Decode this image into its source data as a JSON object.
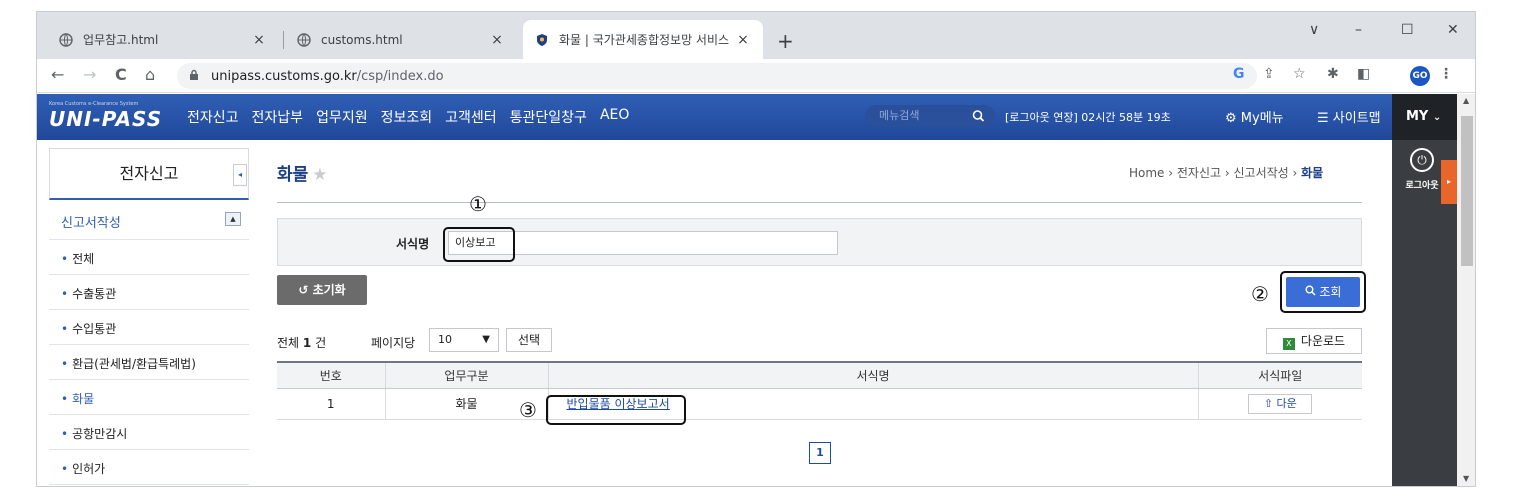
{
  "browser": {
    "tabs": [
      {
        "title": "업무참고.html",
        "close": "×"
      },
      {
        "title": "customs.html",
        "close": "×"
      },
      {
        "title": "화물 | 국가관세종합정보망 서비스",
        "close": "×"
      }
    ],
    "new_tab": "+",
    "window_controls": {
      "menu": "∨",
      "minimize": "–",
      "maximize": "☐",
      "close": "✕"
    },
    "nav": {
      "back": "←",
      "forward": "→",
      "reload": "C",
      "home": "⌂"
    },
    "url_domain": "unipass.customs.go.kr",
    "url_path": "/csp/index.do",
    "profile_initials": "GO"
  },
  "site": {
    "logo_tagline": "Korea Customs e-Clearance System",
    "logo_text": "UNI-PASS",
    "menu": [
      "전자신고",
      "전자납부",
      "업무지원",
      "정보조회",
      "고객센터",
      "통관단일창구",
      "AEO"
    ],
    "search_placeholder": "메뉴검색",
    "session": "[로그아웃 연장] 02시간 58분 19초",
    "my_menu": "My메뉴",
    "sitemap": "사이트맵",
    "my": "MY",
    "logout": "로그아웃"
  },
  "sidebar": {
    "title": "전자신고",
    "section": "신고서작성",
    "items": [
      "전체",
      "수출통관",
      "수입통관",
      "환급(관세법/환급특례법)",
      "화물",
      "공항만감시",
      "인허가"
    ]
  },
  "main": {
    "title": "화물",
    "breadcrumb": [
      "Home",
      "전자신고",
      "신고서작성",
      "화물"
    ],
    "form_label": "서식명",
    "form_value": "이상보고",
    "reset_label": "초기화",
    "search_label": "조회",
    "total_prefix": "전체",
    "total_count": "1",
    "total_suffix": "건",
    "per_page_label": "페이지당",
    "per_page_value": "10",
    "select_label": "선택",
    "download_label": "다운로드",
    "table": {
      "headers": [
        "번호",
        "업무구분",
        "서식명",
        "서식파일"
      ],
      "rows": [
        {
          "no": "1",
          "category": "화물",
          "name": "반입물품 이상보고서",
          "file": "다운"
        }
      ]
    },
    "page": "1"
  },
  "annotations": [
    "①",
    "②",
    "③"
  ],
  "colors": {
    "brand_blue": "#2f5fb5",
    "accent_orange": "#e8652b",
    "search_button": "#3a6ed6"
  }
}
